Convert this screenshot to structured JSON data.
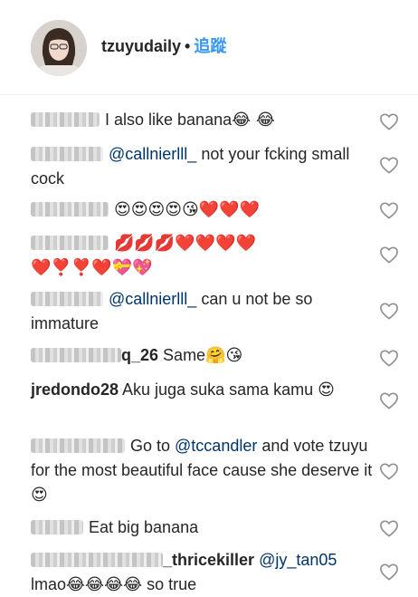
{
  "header": {
    "username": "tzuyudaily",
    "separator": "•",
    "follow_label": "追蹤"
  },
  "comments": [
    {
      "user_suffix": "",
      "mention": "",
      "text": "I also like banana",
      "emoji": "😂 😂"
    },
    {
      "user_suffix": "",
      "mention": "@callnierlll_",
      "text": " not your fcking small cock",
      "emoji": ""
    },
    {
      "user_suffix": "",
      "mention": "",
      "text": "",
      "emoji": "😍😍😍😍😘❤️❤️❤️"
    },
    {
      "user_suffix": "",
      "mention": "",
      "text": "",
      "emoji": "💋💋💋❤️❤️❤️❤️ ❤️❣️❣️❤️💝💖"
    },
    {
      "user_suffix": "",
      "mention": "@callnierlll_",
      "text": " can u not be so immature",
      "emoji": ""
    },
    {
      "user_suffix": "q_26",
      "mention": "",
      "text": "Same",
      "emoji": "🤗😘"
    },
    {
      "user_suffix": "jredondo28",
      "mention": "",
      "text": "Aku juga suka sama kamu",
      "emoji": "😍"
    },
    {
      "user_suffix": "",
      "mention": "@tccandler",
      "text_before": "Go to ",
      "text": " and vote tzuyu for the most beautiful face cause she deserve it",
      "emoji": "😍"
    },
    {
      "user_suffix": "",
      "mention": "",
      "text": "Eat big banana",
      "emoji": ""
    },
    {
      "user_suffix": "_thricekiller",
      "mention": "@jy_tan05",
      "text": "lmao",
      "emoji": "😂😂😂😂",
      "text_after": " so true"
    }
  ],
  "icons": {
    "like": "heart-outline-icon"
  },
  "colors": {
    "follow": "#3897f0",
    "mention": "#003569",
    "text": "#262626",
    "heart_outline": "#8e8e8e"
  }
}
